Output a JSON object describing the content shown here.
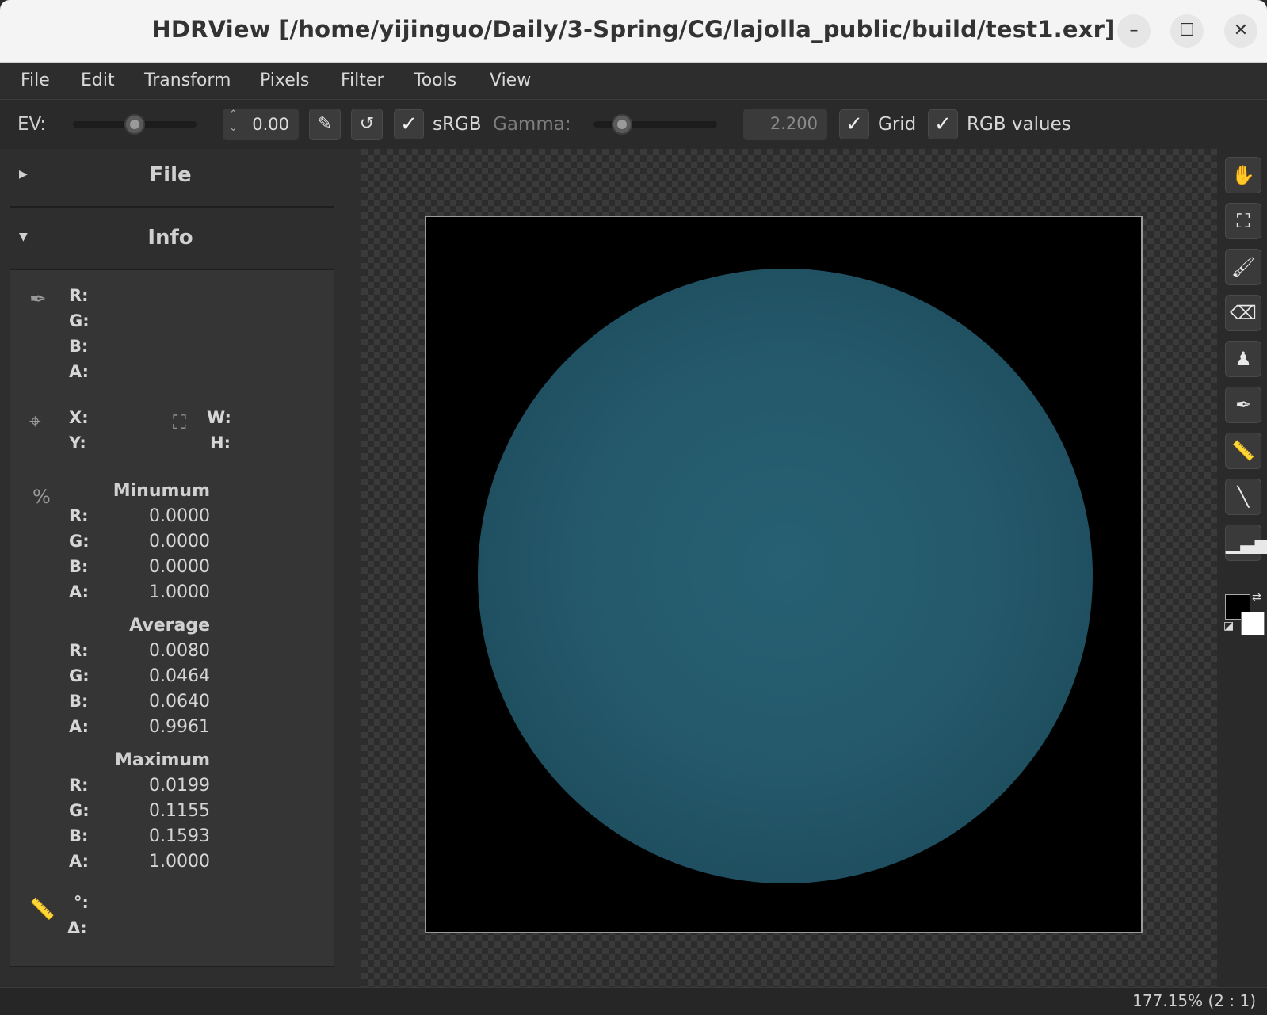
{
  "window": {
    "title": "HDRView [/home/yijinguo/Daily/3-Spring/CG/lajolla_public/build/test1.exr]",
    "minimize": "–",
    "maximize": "☐",
    "close": "✕"
  },
  "menu": [
    "File",
    "Edit",
    "Transform",
    "Pixels",
    "Filter",
    "Tools",
    "View"
  ],
  "toolbar": {
    "ev_label": "EV:",
    "ev_value": "0.00",
    "srgb_label": "sRGB",
    "srgb_checked": true,
    "gamma_label": "Gamma:",
    "gamma_value": "2.200",
    "grid_label": "Grid",
    "grid_checked": true,
    "rgb_values_label": "RGB values",
    "rgb_values_checked": true
  },
  "sidepanel": {
    "file_section": "File",
    "info_section": "Info",
    "pixel": {
      "r": "R:",
      "g": "G:",
      "b": "B:",
      "a": "A:"
    },
    "coords": {
      "x": "X:",
      "y": "Y:",
      "w": "W:",
      "h": "H:"
    },
    "minimum": {
      "title": "Minumum",
      "r": "0.0000",
      "g": "0.0000",
      "b": "0.0000",
      "a": "1.0000"
    },
    "average": {
      "title": "Average",
      "r": "0.0080",
      "g": "0.0464",
      "b": "0.0640",
      "a": "0.9961"
    },
    "maximum": {
      "title": "Maximum",
      "r": "0.0199",
      "g": "0.1155",
      "b": "0.1593",
      "a": "1.0000"
    },
    "ruler": {
      "angle": "°:",
      "delta": "Δ:"
    }
  },
  "status": {
    "zoom": "177.15% (2 : 1)"
  },
  "colors": {
    "sphere": "#24596b",
    "background": "#000000"
  },
  "icons": [
    "hand-icon",
    "fit-icon",
    "brush-icon",
    "eraser-icon",
    "stamp-icon",
    "eyedropper-icon",
    "ruler-icon",
    "line-icon",
    "histogram-icon"
  ]
}
